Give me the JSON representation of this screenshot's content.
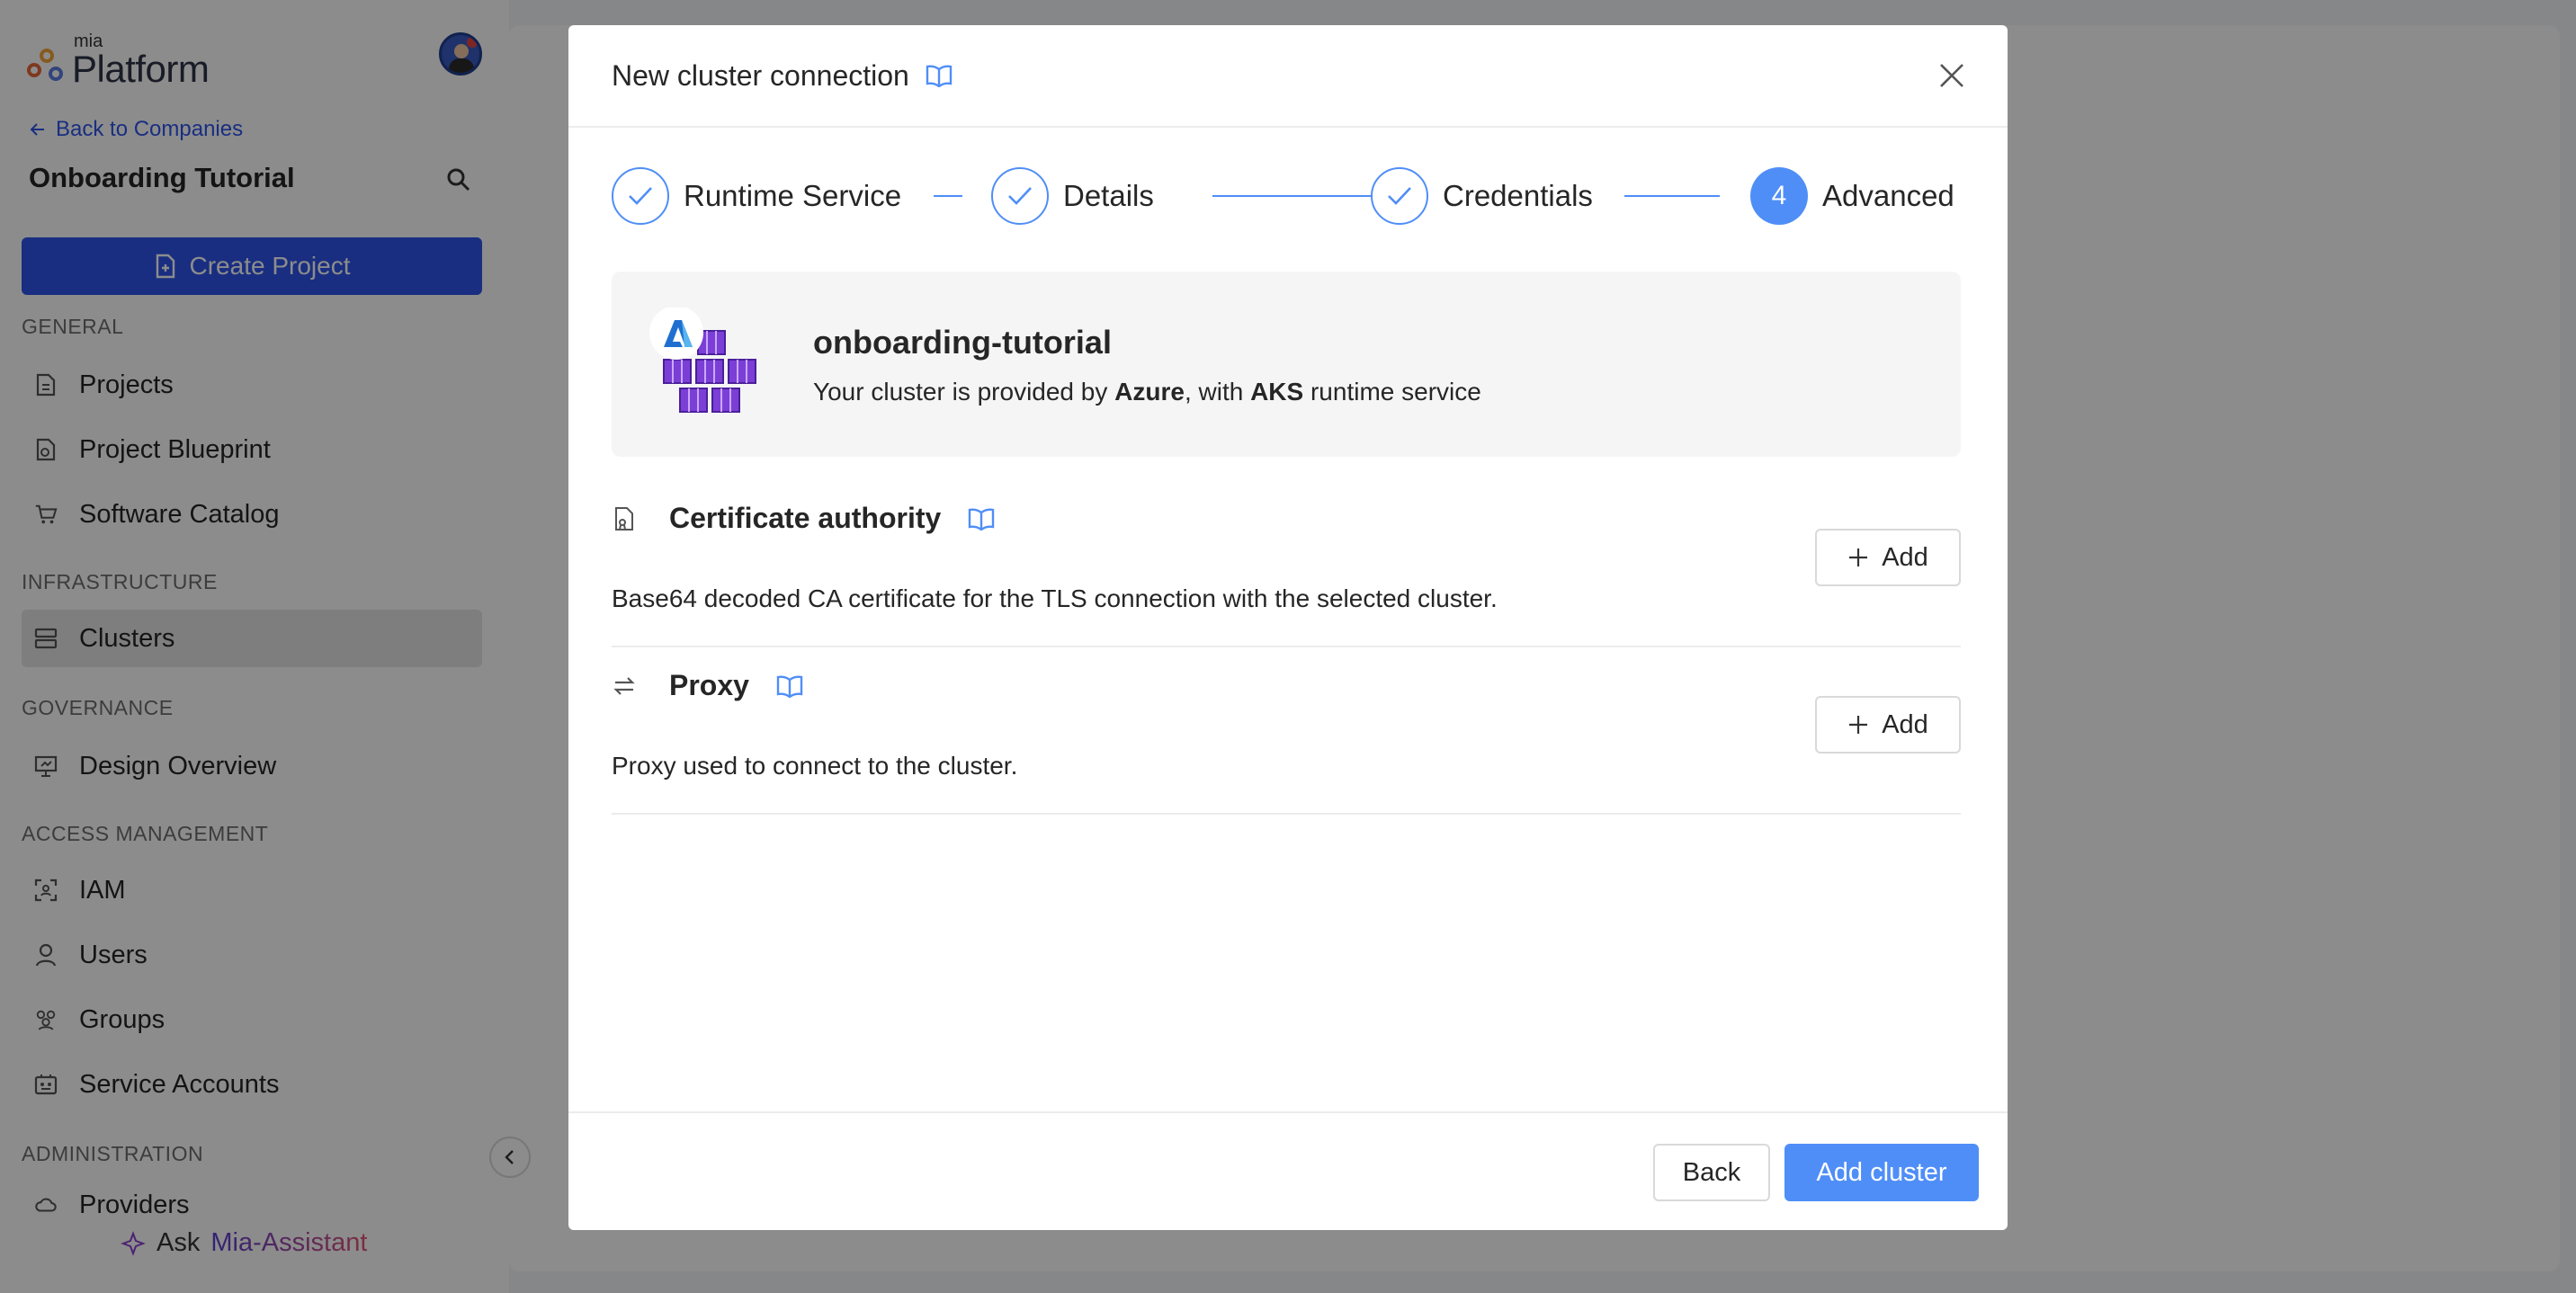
{
  "sidebar": {
    "logo_small": "mia",
    "logo_big": "Platform",
    "back_label": "Back to Companies",
    "tenant_name": "Onboarding Tutorial",
    "create_project_label": "Create Project",
    "sections": {
      "general": "GENERAL",
      "infrastructure": "INFRASTRUCTURE",
      "governance": "GOVERNANCE",
      "access": "ACCESS MANAGEMENT",
      "administration": "ADMINISTRATION"
    },
    "items": {
      "projects": "Projects",
      "blueprint": "Project Blueprint",
      "catalog": "Software Catalog",
      "clusters": "Clusters",
      "design": "Design Overview",
      "iam": "IAM",
      "users": "Users",
      "groups": "Groups",
      "service_accounts": "Service Accounts",
      "providers": "Providers"
    },
    "assistant_prefix": "Ask",
    "assistant_name": "Mia-Assistant"
  },
  "modal": {
    "title": "New cluster connection",
    "steps": [
      {
        "label": "Runtime Service",
        "state": "done"
      },
      {
        "label": "Details",
        "state": "done"
      },
      {
        "label": "Credentials",
        "state": "done"
      },
      {
        "label": "Advanced",
        "state": "current",
        "number": "4"
      }
    ],
    "cluster": {
      "name": "onboarding-tutorial",
      "desc_prefix": "Your cluster is provided by ",
      "provider": "Azure",
      "desc_mid": ", with ",
      "runtime": "AKS",
      "desc_suffix": " runtime service"
    },
    "sections": [
      {
        "title": "Certificate authority",
        "description": "Base64 decoded CA certificate for the TLS connection with the selected cluster.",
        "button": "Add"
      },
      {
        "title": "Proxy",
        "description": "Proxy used to connect to the cluster.",
        "button": "Add"
      }
    ],
    "footer": {
      "back": "Back",
      "submit": "Add cluster"
    }
  },
  "colors": {
    "primary": "#2f54eb",
    "step_blue": "#4f8ef7",
    "cube_purple": "#7b3fd6",
    "azure_blue": "#1f6fd1"
  }
}
